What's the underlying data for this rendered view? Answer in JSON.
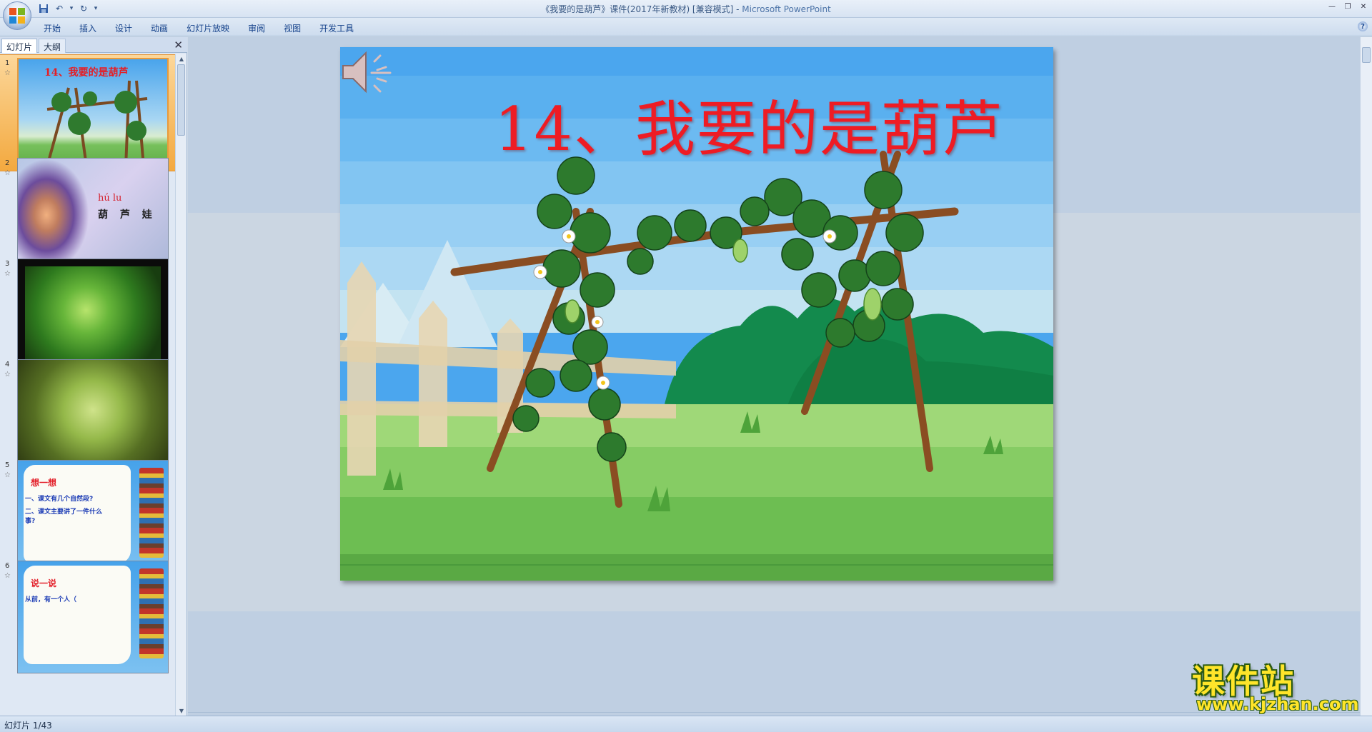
{
  "window": {
    "title": "《我要的是葫芦》课件(2017年新教材) [兼容模式] - ",
    "app_name": "Microsoft PowerPoint"
  },
  "quick_access": {
    "save_icon": "save-icon",
    "undo_icon": "undo-icon",
    "redo_icon": "redo-icon"
  },
  "ribbon": {
    "tabs": [
      "开始",
      "插入",
      "设计",
      "动画",
      "幻灯片放映",
      "审阅",
      "视图",
      "开发工具"
    ]
  },
  "left_panel": {
    "tabs": {
      "slides": "幻灯片",
      "outline": "大纲"
    },
    "thumbnails": [
      {
        "number": "1",
        "title": "14、我要的是葫芦"
      },
      {
        "number": "2",
        "pinyin": "hú  lu",
        "hanzi": "葫 芦 娃"
      },
      {
        "number": "3"
      },
      {
        "number": "4"
      },
      {
        "number": "5",
        "heading": "想一想",
        "line1": "一、课文有几个自然段?",
        "line2": "二、课文主要讲了一件什么事?"
      },
      {
        "number": "6",
        "heading": "说一说",
        "line1": "从前，有一个人（"
      }
    ]
  },
  "slide": {
    "title": "14、我要的是葫芦",
    "audio_icon": "speaker-icon"
  },
  "status_bar": {
    "slide_info": "幻灯片 1/43"
  },
  "watermark": {
    "cn": "课件站",
    "url": "www.kjzhan.com"
  },
  "colors": {
    "title_red": "#ee1c24",
    "sky_blue": "#49a3ec",
    "grass_green": "#5fb24a",
    "selection_orange": "#f3a93f"
  }
}
